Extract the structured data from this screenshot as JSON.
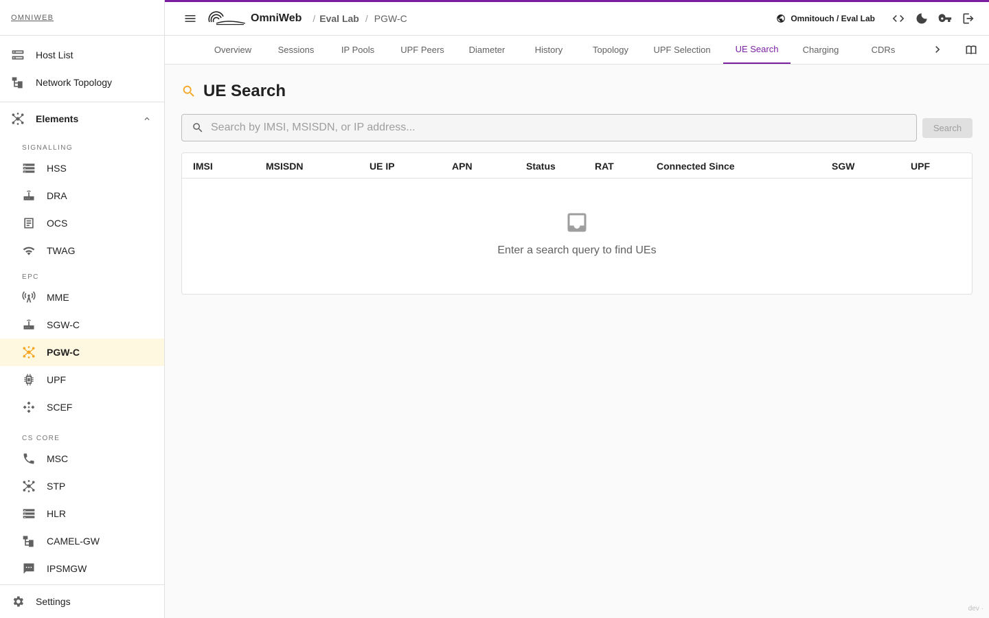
{
  "brand": "OMNIWEB",
  "sidebar": {
    "top_items": [
      {
        "label": "Host List",
        "icon": "server-icon"
      },
      {
        "label": "Network Topology",
        "icon": "topology-icon"
      }
    ],
    "elements_label": "Elements",
    "sections": [
      {
        "label": "SIGNALLING",
        "items": [
          "HSS",
          "DRA",
          "OCS",
          "TWAG"
        ]
      },
      {
        "label": "EPC",
        "items": [
          "MME",
          "SGW-C",
          "PGW-C",
          "UPF",
          "SCEF"
        ]
      },
      {
        "label": "CS CORE",
        "items": [
          "MSC",
          "STP",
          "HLR",
          "CAMEL-GW",
          "IPSMGW"
        ]
      }
    ],
    "active_item": "PGW-C",
    "settings_label": "Settings"
  },
  "topbar": {
    "app_name": "OmniWeb",
    "breadcrumb_sep": "/",
    "breadcrumb": [
      "Eval Lab",
      "PGW-C"
    ],
    "org": "Omnitouch / Eval Lab",
    "accent_color": "#7b1fa2"
  },
  "tabs": [
    "Overview",
    "Sessions",
    "IP Pools",
    "UPF Peers",
    "Diameter",
    "History",
    "Topology",
    "UPF Selection",
    "UE Search",
    "Charging",
    "CDRs"
  ],
  "active_tab": "UE Search",
  "main": {
    "title": "UE Search",
    "search_placeholder": "Search by IMSI, MSISDN, or IP address...",
    "search_button": "Search",
    "columns": [
      "IMSI",
      "MSISDN",
      "UE IP",
      "APN",
      "Status",
      "RAT",
      "Connected Since",
      "SGW",
      "UPF"
    ],
    "empty_message": "Enter a search query to find UEs"
  },
  "footer_tag": "dev ·"
}
